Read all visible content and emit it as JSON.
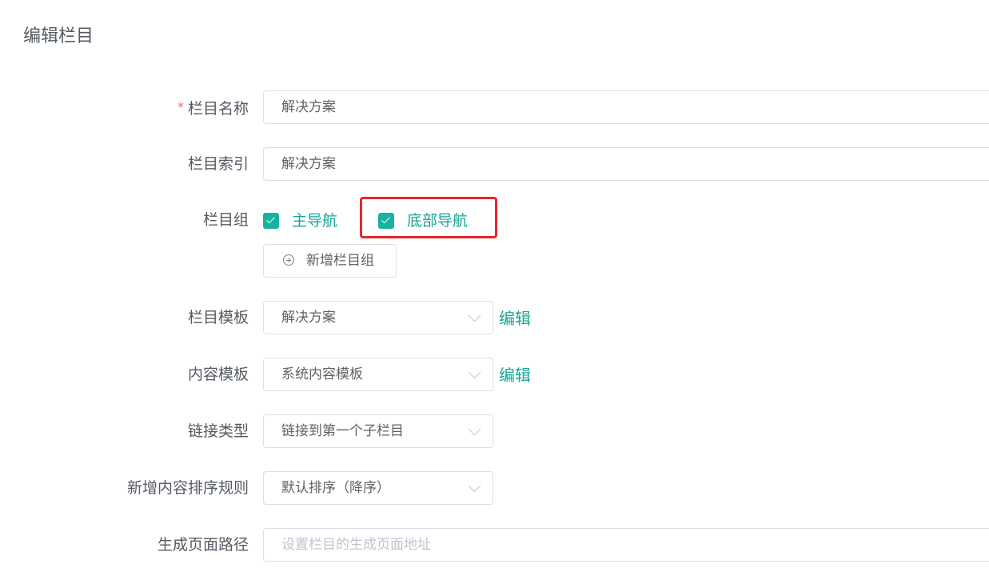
{
  "page": {
    "title": "编辑栏目"
  },
  "form": {
    "name": {
      "label": "栏目名称",
      "required_mark": "*",
      "value": "解决方案"
    },
    "index": {
      "label": "栏目索引",
      "value": "解决方案"
    },
    "group": {
      "label": "栏目组",
      "options": [
        {
          "label": "主导航",
          "checked": true
        },
        {
          "label": "底部导航",
          "checked": true
        }
      ],
      "add_button": "新增栏目组"
    },
    "column_template": {
      "label": "栏目模板",
      "value": "解决方案",
      "edit_link": "编辑"
    },
    "content_template": {
      "label": "内容模板",
      "value": "系统内容模板",
      "edit_link": "编辑"
    },
    "link_type": {
      "label": "链接类型",
      "value": "链接到第一个子栏目"
    },
    "sort_rule": {
      "label": "新增内容排序规则",
      "value": "默认排序（降序）"
    },
    "path": {
      "label": "生成页面路径",
      "placeholder": "设置栏目的生成页面地址"
    }
  },
  "colors": {
    "accent": "#17b2a1",
    "link": "#17a597",
    "highlight": "#e8262a",
    "required": "#f56c6c"
  },
  "icons": {
    "checkbox": "check-icon",
    "add": "plus-circle-icon",
    "select": "chevron-down-icon"
  }
}
